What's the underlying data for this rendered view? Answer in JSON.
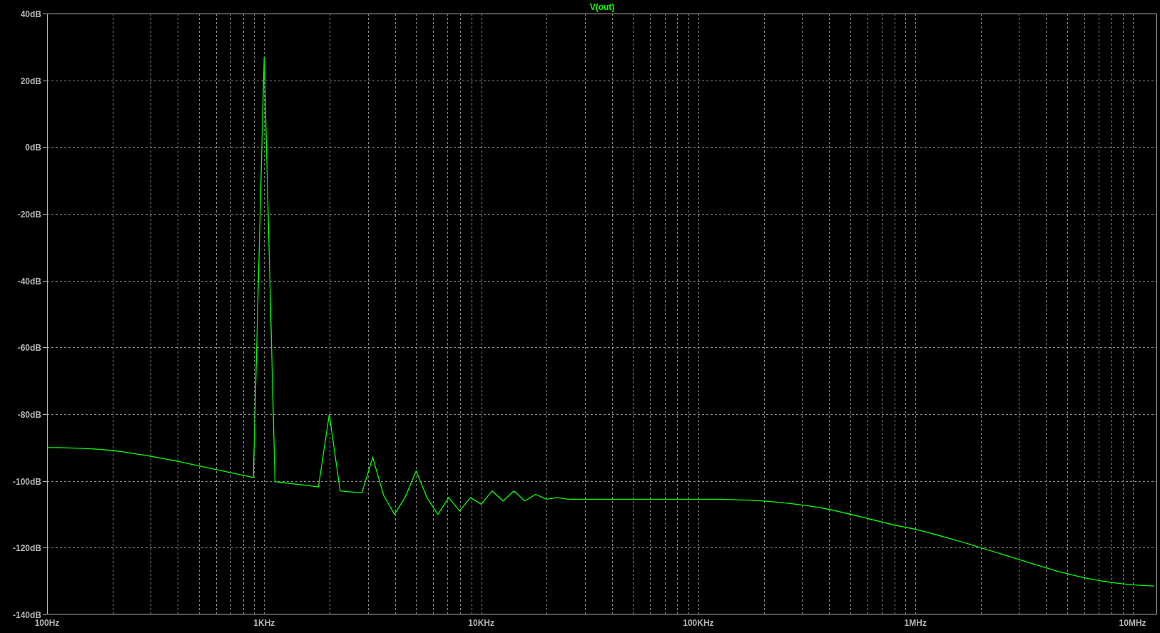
{
  "plot": {
    "chart_data": {
      "type": "line",
      "grid": true,
      "ylim": [
        -140,
        40
      ],
      "categories": [
        "100Hz",
        null,
        null,
        null,
        null,
        null,
        null,
        null,
        null,
        null,
        null,
        null,
        null,
        null,
        null,
        null,
        null,
        null,
        null,
        null,
        "1KHz",
        null,
        null,
        null,
        null,
        null,
        null,
        null,
        null,
        null,
        null,
        null,
        null,
        null,
        null,
        null,
        null,
        null,
        null,
        null,
        "10KHz",
        null,
        null,
        null,
        null,
        null,
        null,
        null,
        null,
        null,
        null,
        null,
        null,
        null,
        null,
        null,
        null,
        null,
        null,
        null,
        "100KHz",
        null,
        null,
        null,
        null,
        null,
        null,
        null,
        null,
        null,
        null,
        null,
        null,
        null,
        null,
        null,
        null,
        null,
        null,
        null,
        "1MHz",
        null,
        null,
        null,
        null,
        null,
        null,
        null,
        null,
        null,
        null,
        null,
        null,
        null,
        null,
        null,
        null,
        null,
        null,
        null,
        "10MHz",
        null,
        null
      ],
      "yticks": [
        {
          "value": 40,
          "label": "40dB"
        },
        {
          "value": 20,
          "label": "20dB"
        },
        {
          "value": 0,
          "label": "0dB"
        },
        {
          "value": -20,
          "label": "-20dB"
        },
        {
          "value": -40,
          "label": "-40dB"
        },
        {
          "value": -60,
          "label": "-60dB"
        },
        {
          "value": -80,
          "label": "-80dB"
        },
        {
          "value": -100,
          "label": "-100dB"
        },
        {
          "value": -120,
          "label": "-120dB"
        },
        {
          "value": -140,
          "label": "-140dB"
        }
      ],
      "series": [
        {
          "name": "V(out)",
          "color": "#00ff00",
          "values": [
            -90,
            -90,
            -90.1,
            -90.2,
            -90.4,
            -90.6,
            -90.9,
            -91.3,
            -91.8,
            -92.3,
            -92.9,
            -93.5,
            -94.1,
            -94.8,
            -95.5,
            -96.2,
            -96.9,
            -97.6,
            -98.3,
            -99,
            27,
            -100.2,
            -100.6,
            -101,
            -101.4,
            -101.8,
            -80,
            -103,
            -103.3,
            -103.5,
            -93,
            -104.3,
            -110,
            -104.8,
            -97,
            -105,
            -110,
            -105,
            -109,
            -105,
            -107,
            -103,
            -106,
            -103,
            -106,
            -104,
            -105.5,
            -105,
            -105.5,
            -105.5,
            -105.5,
            -105.5,
            -105.5,
            -105.5,
            -105.5,
            -105.5,
            -105.5,
            -105.5,
            -105.5,
            -105.5,
            -105.5,
            -105.5,
            -105.5,
            -105.6,
            -105.7,
            -105.8,
            -106,
            -106.3,
            -106.6,
            -107,
            -107.4,
            -107.9,
            -108.5,
            -109.2,
            -110,
            -110.8,
            -111.6,
            -112.4,
            -113.2,
            -113.8,
            -114.5,
            -115.3,
            -116.2,
            -117.1,
            -118,
            -119,
            -120,
            -121,
            -122,
            -123,
            -124,
            -125,
            -126,
            -127,
            -127.8,
            -128.6,
            -129.3,
            -129.9,
            -130.4,
            -130.8,
            -131.1,
            -131.3,
            -131.5
          ]
        }
      ]
    }
  }
}
